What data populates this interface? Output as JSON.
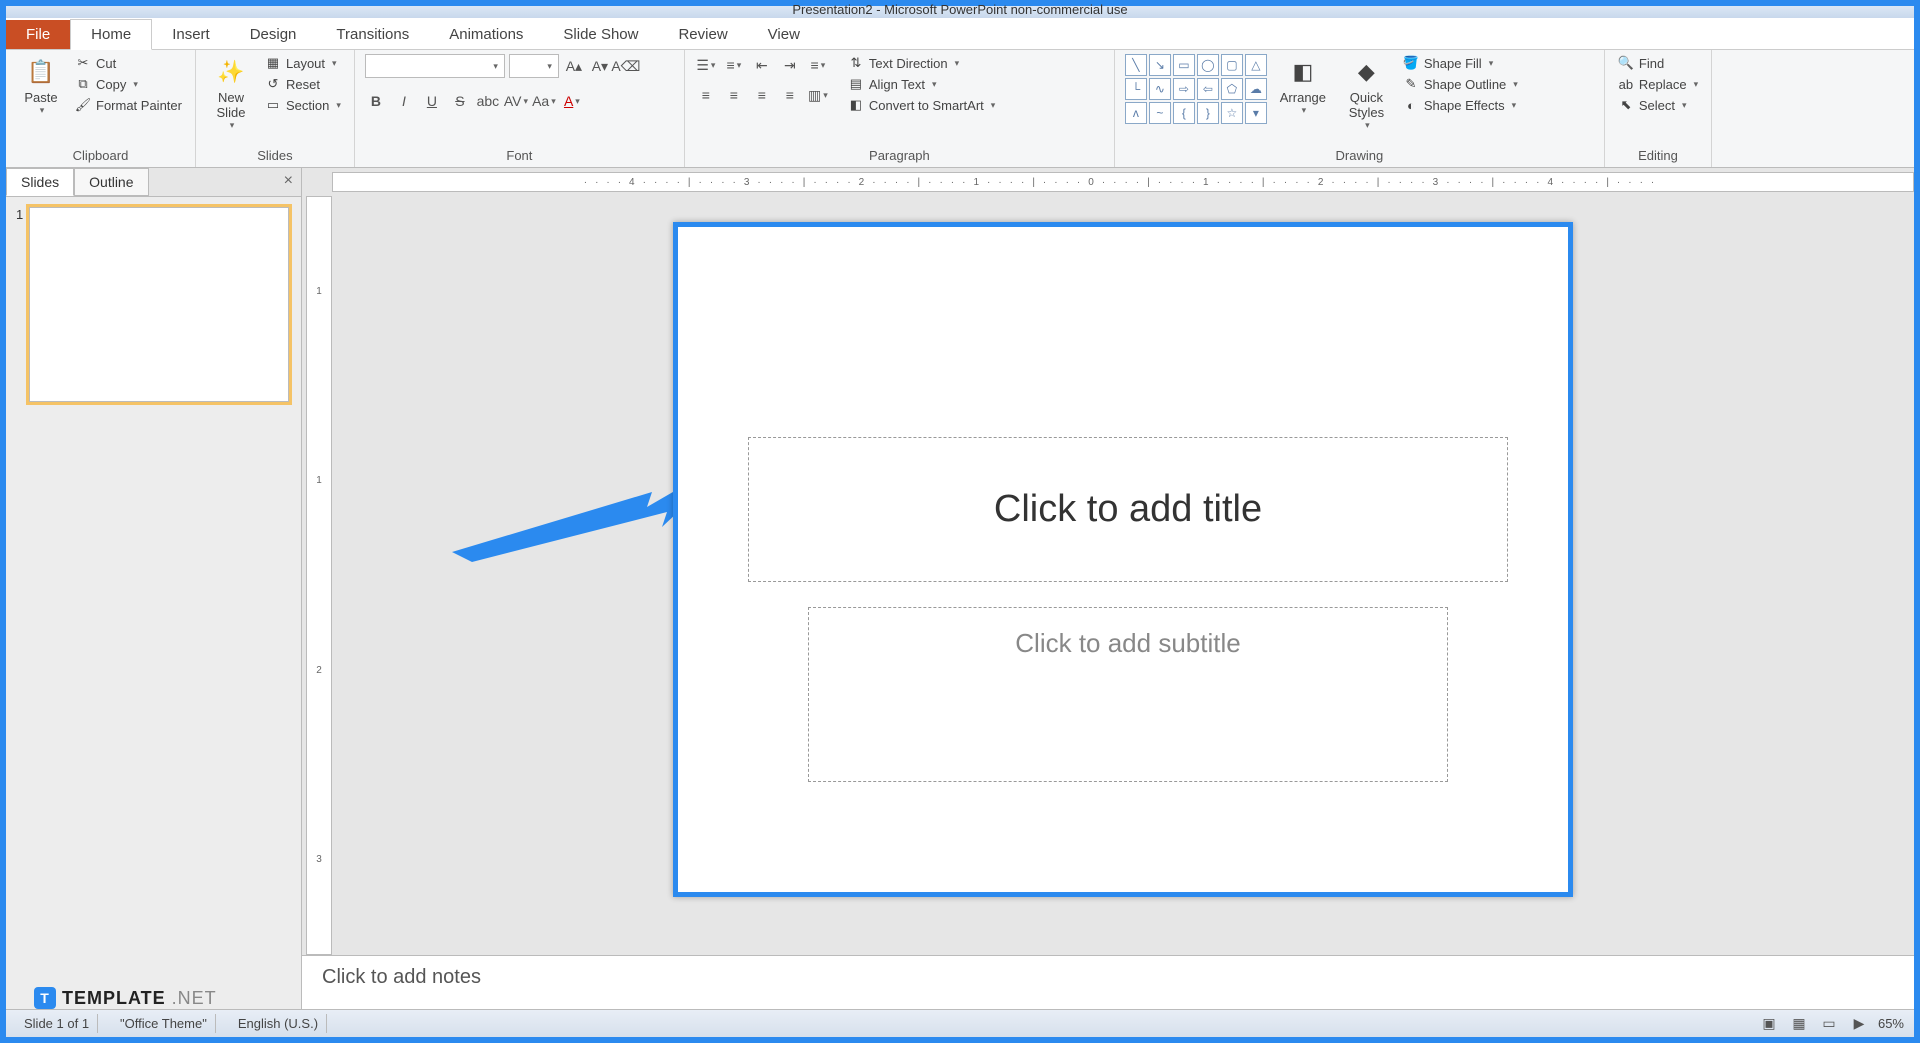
{
  "window": {
    "title": "Presentation2 - Microsoft PowerPoint non-commercial use"
  },
  "tabs": {
    "file": "File",
    "home": "Home",
    "insert": "Insert",
    "design": "Design",
    "transitions": "Transitions",
    "animations": "Animations",
    "slideshow": "Slide Show",
    "review": "Review",
    "view": "View"
  },
  "ribbon": {
    "clipboard": {
      "label": "Clipboard",
      "paste": "Paste",
      "cut": "Cut",
      "copy": "Copy",
      "format_painter": "Format Painter"
    },
    "slides": {
      "label": "Slides",
      "new_slide": "New\nSlide",
      "layout": "Layout",
      "reset": "Reset",
      "section": "Section"
    },
    "font": {
      "label": "Font"
    },
    "paragraph": {
      "label": "Paragraph",
      "text_direction": "Text Direction",
      "align_text": "Align Text",
      "convert_smartart": "Convert to SmartArt"
    },
    "drawing": {
      "label": "Drawing",
      "arrange": "Arrange",
      "quick_styles": "Quick\nStyles",
      "shape_fill": "Shape Fill",
      "shape_outline": "Shape Outline",
      "shape_effects": "Shape Effects"
    },
    "editing": {
      "label": "Editing",
      "find": "Find",
      "replace": "Replace",
      "select": "Select"
    }
  },
  "left_pane": {
    "slides_tab": "Slides",
    "outline_tab": "Outline",
    "thumb_num": "1"
  },
  "slide": {
    "title_placeholder": "Click to add title",
    "subtitle_placeholder": "Click to add subtitle"
  },
  "notes": {
    "placeholder": "Click to add notes"
  },
  "statusbar": {
    "slide_info": "Slide 1 of 1",
    "theme": "\"Office Theme\"",
    "language": "English (U.S.)",
    "zoom": "65%"
  },
  "ruler": {
    "h_marks": "····4····|····3····|····2····|····1····|····0····|····1····|····2····|····3····|····4····|····",
    "v_marks": [
      "1",
      "",
      "1",
      "",
      "2",
      "",
      "3",
      ""
    ]
  },
  "watermark": {
    "brand": "TEMPLATE",
    "suffix": ".NET"
  }
}
